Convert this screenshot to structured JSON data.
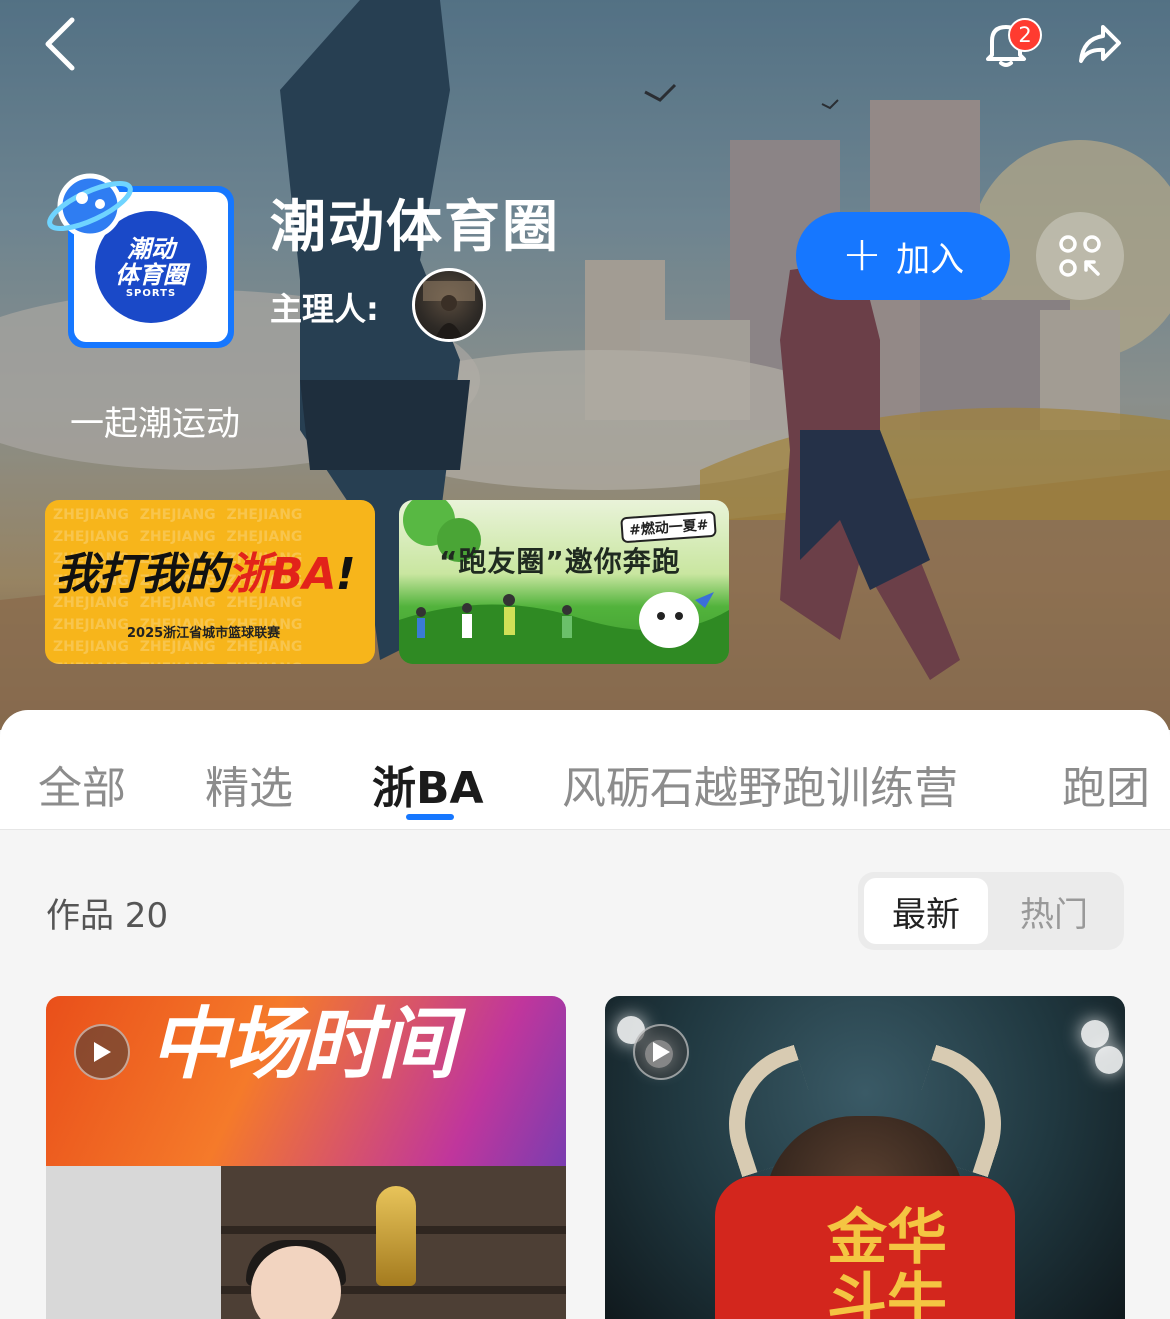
{
  "header": {
    "notification_count": "2",
    "circle_title": "潮动体育圈",
    "logo_text_line1": "潮动",
    "logo_text_line2": "体育圈",
    "logo_text_small": "SPORTS",
    "owner_label": "主理人:",
    "description": "一起潮运动",
    "join_label": "加入"
  },
  "banners": [
    {
      "main_text_prefix": "我打我的",
      "main_text_highlight": "浙BA",
      "main_text_suffix": "!",
      "sub_text": "2025浙江省城市篮球联赛",
      "background_text": "ZHEJIANG ZHEJIANG ZHEJIANG ZHEJIANG ZHEJIANG ZHEJIANG ZHEJIANG ZHEJIANG ZHEJIANG ZHEJIANG ZHEJIANG ZHEJIANG ZHEJIANG ZHEJIANG ZHEJIANG ZHEJIANG ZHEJIANG ZHEJIANG ZHEJIANG ZHEJIANG ZHEJIANG ZHEJIANG ZHEJIANG ZHEJIANG ZHEJIANG ZHEJIANG ZHEJIANG ZHEJIANG"
    },
    {
      "tag": "#燃动一夏#",
      "title": "“跑友圈”邀你奔跑"
    }
  ],
  "tabs": [
    {
      "label": "全部",
      "active": false
    },
    {
      "label": "精选",
      "active": false
    },
    {
      "label": "浙BA",
      "active": true
    },
    {
      "label": "风砺石越野跑训练营",
      "active": false
    },
    {
      "label": "跑团",
      "active": false
    }
  ],
  "works": {
    "label": "作品 20",
    "sort_options": [
      "最新",
      "热门"
    ],
    "active_sort": "最新"
  },
  "cards": [
    {
      "title_text": "中场时间"
    },
    {
      "jersey_text": "金华斗牛"
    }
  ],
  "colors": {
    "accent": "#1677ff",
    "badge": "#ff3b30"
  }
}
